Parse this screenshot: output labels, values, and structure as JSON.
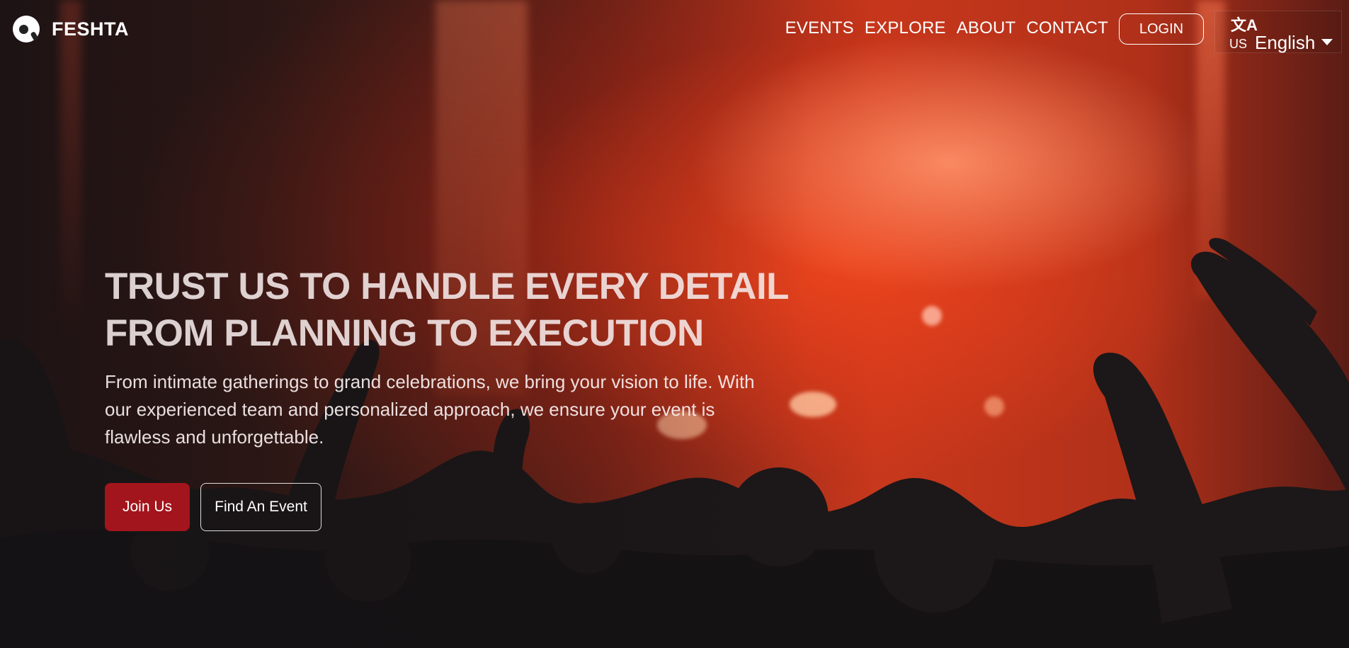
{
  "brand": {
    "name": "FESHTA",
    "logo_icon": "vinyl-record-icon"
  },
  "nav": {
    "links": [
      "EVENTS",
      "EXPLORE",
      "ABOUT",
      "CONTACT"
    ],
    "login_label": "LOGIN"
  },
  "language": {
    "icon": "translate-icon",
    "code": "US",
    "selected": "English"
  },
  "hero": {
    "headline_line1": "TRUST US TO HANDLE EVERY DETAIL",
    "headline_line2": "FROM PLANNING TO EXECUTION",
    "subtitle_line1": "From intimate gatherings to grand celebrations, we bring your vision to life. With",
    "subtitle_line2": "our experienced team and personalized approach, we ensure your event is",
    "subtitle_line3": "flawless and unforgettable.",
    "primary_cta": "Join Us",
    "secondary_cta": "Find An Event"
  },
  "colors": {
    "accent": "#a3151c",
    "text": "#ffffff"
  }
}
